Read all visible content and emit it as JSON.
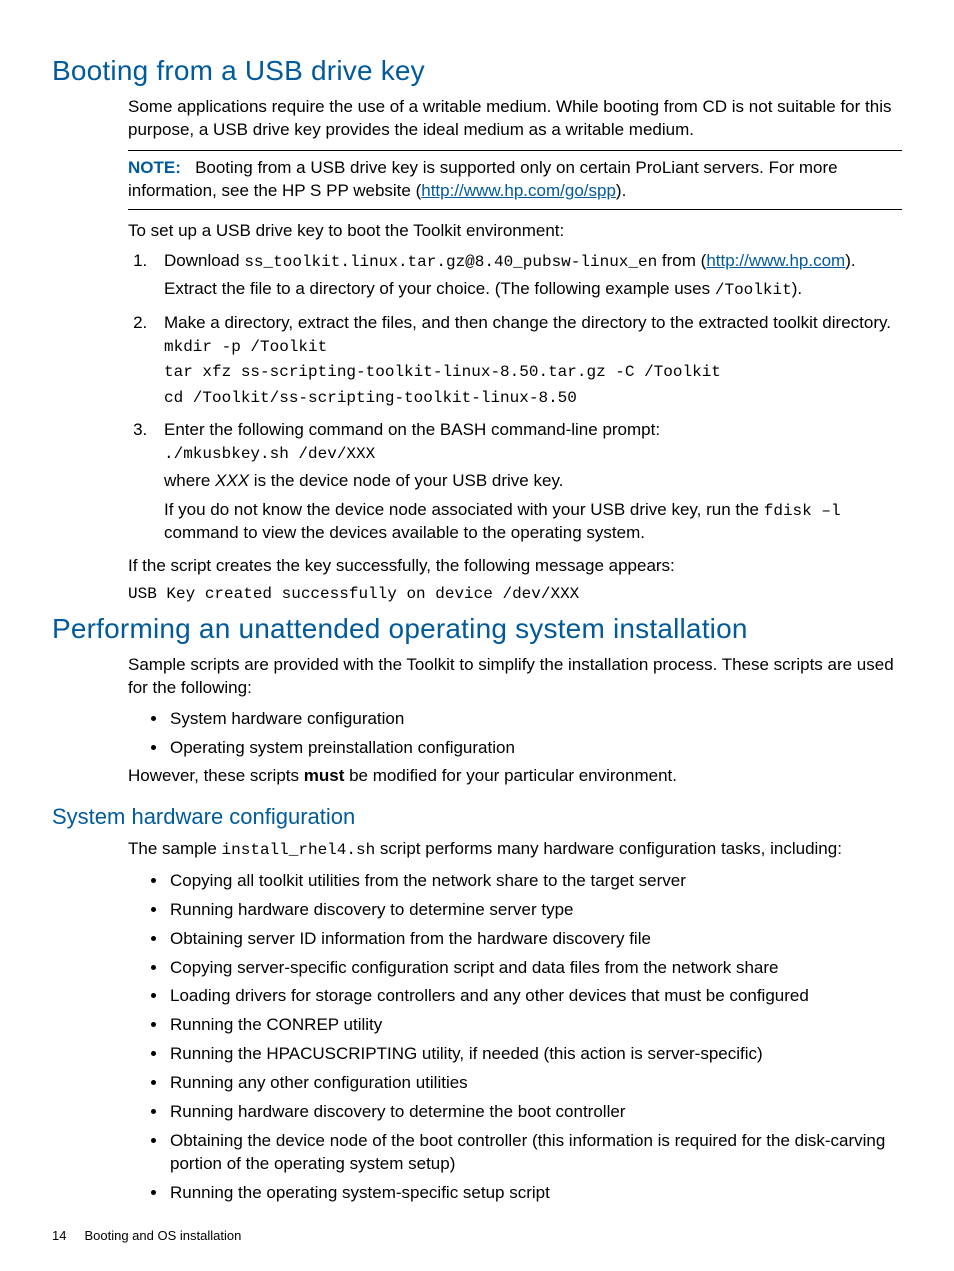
{
  "section1": {
    "heading": "Booting from a USB drive key",
    "intro": "Some applications require the use of a writable medium. While booting from CD is not suitable for this purpose, a USB drive key provides the ideal medium as a writable medium.",
    "note_label": "NOTE:",
    "note_pre": "Booting from a USB drive key is supported only on certain ProLiant servers. For more information, see the HP S PP website (",
    "note_link": "http://www.hp.com/go/spp",
    "note_post": ").",
    "setup_lead": "To set up a USB drive key to boot the Toolkit environment:",
    "step1_pre": "Download ",
    "step1_code": "ss_toolkit.linux.tar.gz@8.40_pubsw-linux_en",
    "step1_mid": " from (",
    "step1_link": "http://www.hp.com",
    "step1_post": ").",
    "step1_extract_pre": "Extract the file to a directory of your choice. (The following example uses ",
    "step1_extract_code": "/Toolkit",
    "step1_extract_post": ").",
    "step2_text": "Make a directory, extract the files, and then change the directory to the extracted toolkit directory.",
    "step2_code1": "mkdir -p /Toolkit",
    "step2_code2": "tar xfz ss-scripting-toolkit-linux-8.50.tar.gz -C /Toolkit",
    "step2_code3": "cd /Toolkit/ss-scripting-toolkit-linux-8.50",
    "step3_text": "Enter the following command on the BASH command-line prompt:",
    "step3_code": "./mkusbkey.sh /dev/XXX",
    "step3_where_pre": "where ",
    "step3_where_it": "XXX",
    "step3_where_post": " is the device node of your USB drive key.",
    "step3_hint_pre": "If you do not know the device node associated with your USB drive key, run the ",
    "step3_hint_code": "fdisk –l",
    "step3_hint_post": " command to view the devices available to the operating system.",
    "result_text": "If the script creates the key successfully, the following message appears:",
    "result_code": "USB Key created successfully on device /dev/XXX"
  },
  "section2": {
    "heading": "Performing an unattended operating system installation",
    "intro": "Sample scripts are provided with the Toolkit to simplify the installation process. These scripts are used for the following:",
    "bullets": [
      "System hardware configuration",
      "Operating system preinstallation configuration"
    ],
    "however_pre": "However, these scripts ",
    "however_bold": "must",
    "however_post": " be modified for your particular environment."
  },
  "section3": {
    "heading": "System hardware configuration",
    "intro_pre": "The sample ",
    "intro_code": "install_rhel4.sh",
    "intro_post": " script performs many hardware configuration tasks, including:",
    "bullets": [
      "Copying all toolkit utilities from the network share to the target server",
      "Running hardware discovery to determine server type",
      "Obtaining server ID information from the hardware discovery file",
      "Copying server-specific configuration script and data files from the network share",
      "Loading drivers for storage controllers and any other devices that must be configured",
      "Running the CONREP utility",
      "Running the HPACUSCRIPTING utility, if needed (this action is server-specific)",
      "Running any other configuration utilities",
      "Running hardware discovery to determine the boot controller",
      "Obtaining the device node of the boot controller (this information is required for the disk-carving portion of the operating system setup)",
      "Running the operating system-specific setup script"
    ]
  },
  "footer": {
    "page": "14",
    "title": "Booting and OS installation"
  }
}
